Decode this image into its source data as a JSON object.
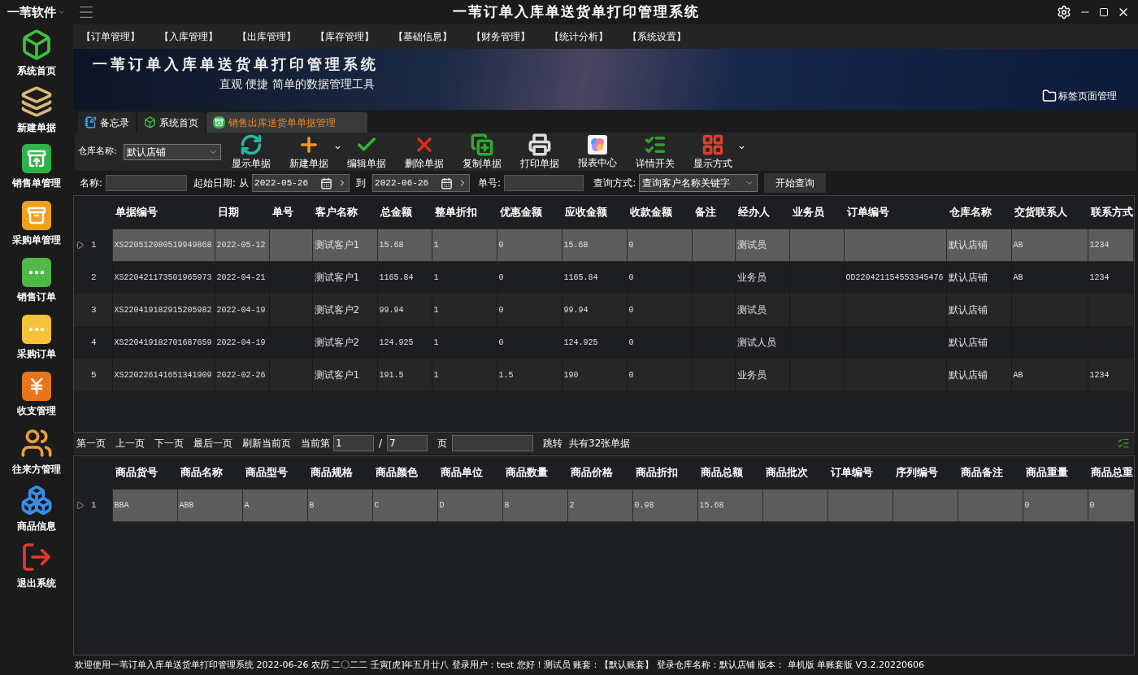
{
  "brand": {
    "name": "一苇软件"
  },
  "window": {
    "title": "一苇订单入库单送货单打印管理系统"
  },
  "sidebar": {
    "items": [
      {
        "label": "系统首页",
        "kind": "cube"
      },
      {
        "label": "新建单据",
        "kind": "layers"
      },
      {
        "label": "销售单管理",
        "kind": "box-out"
      },
      {
        "label": "采购单管理",
        "kind": "box-in"
      },
      {
        "label": "销售订单",
        "kind": "dots-green"
      },
      {
        "label": "采购订单",
        "kind": "dots-yellow"
      },
      {
        "label": "收支管理",
        "kind": "yen"
      },
      {
        "label": "往来方管理",
        "kind": "users"
      },
      {
        "label": "商品信息",
        "kind": "boxes"
      },
      {
        "label": "退出系统",
        "kind": "exit"
      }
    ]
  },
  "menu": [
    "【订单管理】",
    "【入库管理】",
    "【出库管理】",
    "【库存管理】",
    "【基础信息】",
    "【财务管理】",
    "【统计分析】",
    "【系统设置】"
  ],
  "banner": {
    "title": "一苇订单入库单送货单打印管理系统",
    "subtitle": "直观 便捷 简单的数据管理工具",
    "tab_manager": "标签页面管理"
  },
  "tabs": [
    {
      "label": "备忘录",
      "kind": "memo",
      "selected": false
    },
    {
      "label": "系统首页",
      "kind": "cube",
      "selected": false
    },
    {
      "label": "销售出库送货单单据管理",
      "kind": "box-out",
      "selected": true
    }
  ],
  "toolbar": {
    "warehouse_label": "仓库名称:",
    "warehouse_value": "默认店铺",
    "buttons": [
      {
        "label": "显示单据",
        "kind": "refresh",
        "dropdown": false
      },
      {
        "label": "新建单据",
        "kind": "add",
        "dropdown": true
      },
      {
        "label": "编辑单据",
        "kind": "check",
        "dropdown": false
      },
      {
        "label": "删除单据",
        "kind": "delete",
        "dropdown": false
      },
      {
        "label": "复制单据",
        "kind": "copy",
        "dropdown": false
      },
      {
        "label": "打印单据",
        "kind": "print",
        "dropdown": false
      },
      {
        "label": "报表中心",
        "kind": "report",
        "dropdown": false
      },
      {
        "label": "详情开关",
        "kind": "details",
        "dropdown": false
      },
      {
        "label": "显示方式",
        "kind": "grid",
        "dropdown": true
      }
    ]
  },
  "filters": {
    "name_label": "名称:",
    "date_label": "起始日期:",
    "from_label": "从",
    "from_date": "2022-05-26",
    "to_label": "到",
    "to_date": "2022-06-26",
    "number_label": "单号:",
    "mode_label": "查询方式:",
    "mode_value": "查询客户名称关键字",
    "search_button": "开始查询"
  },
  "orders": {
    "columns": [
      "单据编号",
      "日期",
      "单号",
      "客户名称",
      "总金额",
      "整单折扣",
      "优惠金额",
      "应收金额",
      "收款金额",
      "备注",
      "经办人",
      "业务员",
      "订单编号",
      "仓库名称",
      "交货联系人",
      "联系方式"
    ],
    "rows": [
      {
        "num": "1",
        "selected": true,
        "cells": [
          "XS220512080519949868",
          "2022-05-12",
          null,
          "测试客户1",
          "15.68",
          "1",
          "0",
          "15.68",
          "0",
          null,
          "测试员",
          null,
          null,
          "默认店铺",
          "AB",
          "1234"
        ]
      },
      {
        "num": "2",
        "selected": false,
        "cells": [
          "XS220421173501965973",
          "2022-04-21",
          null,
          "测试客户1",
          "1165.84",
          "1",
          "0",
          "1165.84",
          "0",
          null,
          "业务员",
          null,
          "OD220421154553345476",
          "默认店铺",
          "AB",
          "1234"
        ]
      },
      {
        "num": "3",
        "selected": false,
        "cells": [
          "XS220419182915205982",
          "2022-04-19",
          null,
          "测试客户2",
          "99.94",
          "1",
          "0",
          "99.94",
          "0",
          null,
          "测试员",
          null,
          null,
          "默认店铺",
          null,
          null
        ]
      },
      {
        "num": "4",
        "selected": false,
        "cells": [
          "XS220419182701687659",
          "2022-04-19",
          null,
          "测试客户2",
          "124.925",
          "1",
          "0",
          "124.925",
          "0",
          null,
          "测试人员",
          null,
          null,
          "默认店铺",
          null,
          null
        ]
      },
      {
        "num": "5",
        "selected": false,
        "cells": [
          "XS220226141651341909",
          "2022-02-26",
          null,
          "测试客户1",
          "191.5",
          "1",
          "1.5",
          "190",
          "0",
          null,
          "业务员",
          null,
          null,
          "默认店铺",
          "AB",
          "1234"
        ]
      }
    ]
  },
  "pager": {
    "links": [
      "第一页",
      "上一页",
      "下一页",
      "最后一页",
      "刷新当前页"
    ],
    "current_label": "当前第",
    "current_page": "1",
    "separator": "/",
    "total_pages": "7",
    "page_label": "页",
    "jump_button": "跳转",
    "total": "共有32张单据"
  },
  "items": {
    "columns": [
      "商品货号",
      "商品名称",
      "商品型号",
      "商品规格",
      "商品颜色",
      "商品单位",
      "商品数量",
      "商品价格",
      "商品折扣",
      "商品总额",
      "商品批次",
      "订单编号",
      "序列编号",
      "商品备注",
      "商品重量",
      "商品总重"
    ],
    "rows": [
      {
        "num": "1",
        "selected": true,
        "cells": [
          "BBA",
          "ABB",
          "A",
          "B",
          "C",
          "D",
          "8",
          "2",
          "0.98",
          "15.68",
          null,
          null,
          null,
          null,
          "0",
          "0"
        ]
      }
    ]
  },
  "status_bar": "欢迎使用一苇订单入库单送货单打印管理系统 2022-06-26 农历 二〇二二 壬寅[虎]年五月廿八 登录用户：test 您好！测试员 账套：【默认账套】 登录仓库名称：默认店铺 版本： 单机版 单账套版 V3.2.20220606"
}
